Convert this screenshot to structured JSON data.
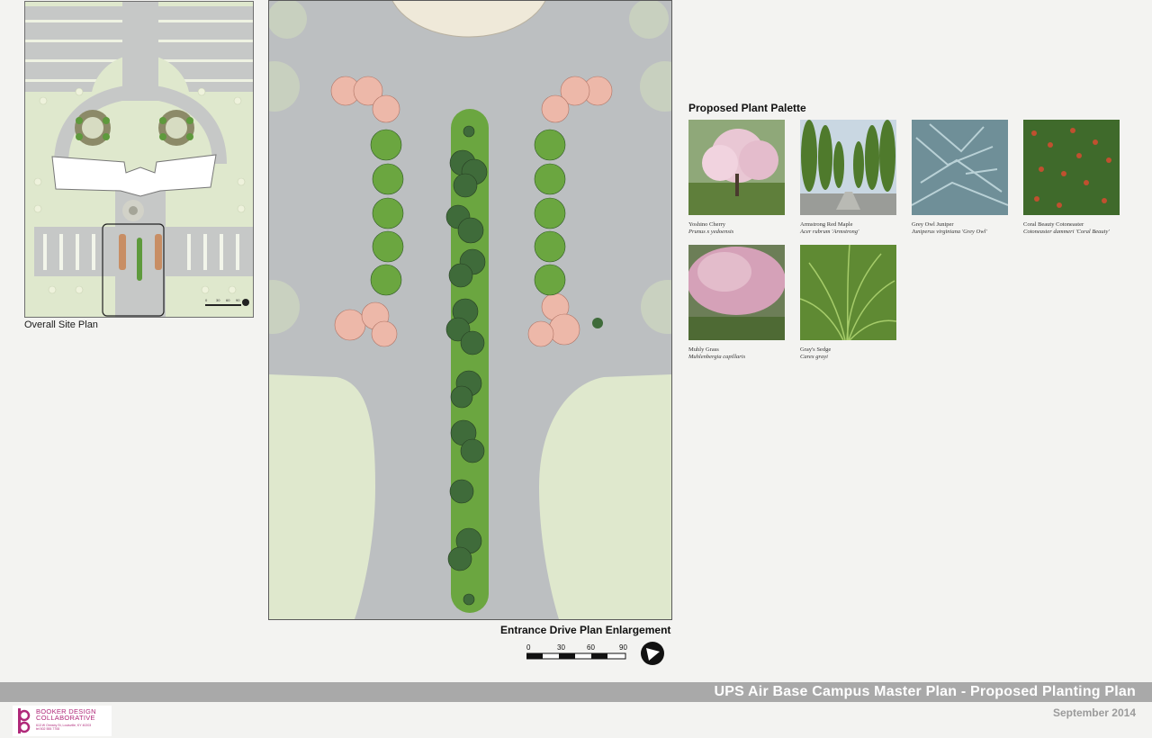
{
  "site_plan": {
    "label": "Overall Site Plan",
    "scale_ticks": [
      "0",
      "30",
      "60",
      "90"
    ]
  },
  "enlargement": {
    "label": "Entrance Drive Plan Enlargement",
    "scale_ticks": [
      "0",
      "30",
      "60",
      "90"
    ]
  },
  "palette": {
    "title": "Proposed Plant Palette",
    "plants": [
      {
        "common": "Yoshino Cherry",
        "latin": "Prunus x yedoensis"
      },
      {
        "common": "Armstrong Red Maple",
        "latin": "Acer rubrum 'Armstrong'"
      },
      {
        "common": "Grey Owl Juniper",
        "latin": "Juniperus virginiana 'Grey Owl'"
      },
      {
        "common": "Coral Beauty Cotoneaster",
        "latin": "Cotoneaster dammeri 'Coral Beauty'"
      },
      {
        "common": "Muhly Grass",
        "latin": "Muhlenbergia capillaris"
      },
      {
        "common": "Gray's Sedge",
        "latin": "Carex grayi"
      }
    ]
  },
  "title_block": {
    "title": "UPS Air Base Campus Master Plan - Proposed Planting Plan",
    "date": "September 2014"
  },
  "logo": {
    "line1": "BOOKER DESIGN",
    "line2": "COLLABORATIVE",
    "address": "613 W Ormsby St, Louisville, KY 40203",
    "phone": "tel 502 555 7708"
  },
  "colors": {
    "accent": "#b0297a",
    "road": "#bcbfc1",
    "lawn": "#dfe8cd",
    "tree_green": "#5e9a3c",
    "cherry_pink": "#e6b3a3"
  }
}
